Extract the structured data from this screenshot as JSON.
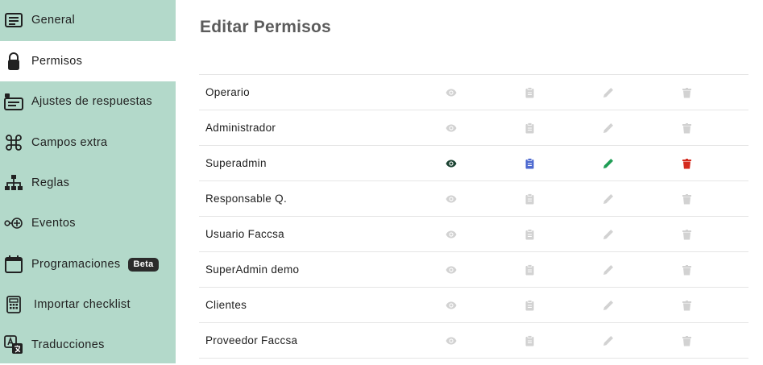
{
  "sidebar": {
    "items": [
      {
        "label": "General",
        "icon": "list-icon"
      },
      {
        "label": "Permisos",
        "icon": "lock-icon",
        "active": true
      },
      {
        "label": "Ajustes de respuestas",
        "icon": "answers-settings-icon"
      },
      {
        "label": "Campos extra",
        "icon": "command-icon"
      },
      {
        "label": "Reglas",
        "icon": "sitemap-icon"
      },
      {
        "label": "Eventos",
        "icon": "event-icon"
      },
      {
        "label": "Programaciones",
        "icon": "calendar-icon",
        "badge": "Beta"
      },
      {
        "label": "Importar checklist",
        "icon": "calculator-icon"
      },
      {
        "label": "Traducciones",
        "icon": "translate-icon"
      }
    ]
  },
  "main": {
    "title": "Editar Permisos",
    "roles": [
      {
        "name": "Operario",
        "view": false,
        "copy": false,
        "edit": false,
        "delete": false
      },
      {
        "name": "Administrador",
        "view": false,
        "copy": false,
        "edit": false,
        "delete": false
      },
      {
        "name": "Superadmin",
        "view": true,
        "copy": true,
        "edit": true,
        "delete": true
      },
      {
        "name": "Responsable Q.",
        "view": false,
        "copy": false,
        "edit": false,
        "delete": false
      },
      {
        "name": "Usuario Faccsa",
        "view": false,
        "copy": false,
        "edit": false,
        "delete": false
      },
      {
        "name": "SuperAdmin demo",
        "view": false,
        "copy": false,
        "edit": false,
        "delete": false
      },
      {
        "name": "Clientes",
        "view": false,
        "copy": false,
        "edit": false,
        "delete": false
      },
      {
        "name": "Proveedor Faccsa",
        "view": false,
        "copy": false,
        "edit": false,
        "delete": false
      }
    ]
  },
  "colors": {
    "sidebar_bg": "#b3d9ca",
    "inactive_icon": "#d2d2d2",
    "view_active": "#1b4332",
    "copy_active": "#4f6bd0",
    "edit_active": "#1f9d55",
    "delete_active": "#d42a1e"
  }
}
